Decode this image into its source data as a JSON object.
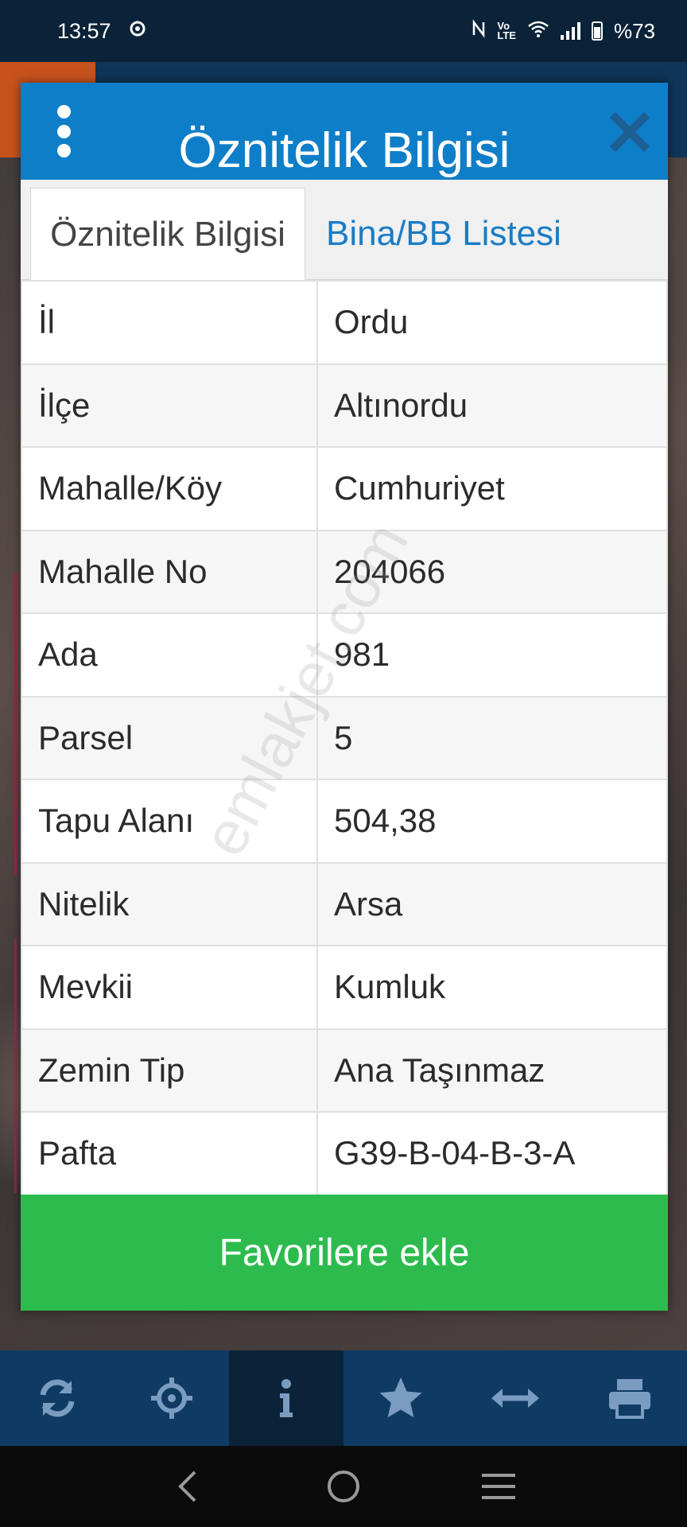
{
  "status_bar": {
    "time": "13:57",
    "battery_text": "%73",
    "icons": [
      "vpn-icon",
      "nfc-icon",
      "volte-icon",
      "wifi-icon",
      "signal-icon",
      "battery-icon"
    ]
  },
  "dialog": {
    "title": "Öznitelik Bilgisi",
    "tabs": [
      {
        "label": "Öznitelik Bilgisi",
        "active": true
      },
      {
        "label": "Bina/BB Listesi",
        "active": false
      }
    ],
    "rows": [
      {
        "key": "İl",
        "value": "Ordu"
      },
      {
        "key": "İlçe",
        "value": "Altınordu"
      },
      {
        "key": "Mahalle/Köy",
        "value": "Cumhuriyet"
      },
      {
        "key": "Mahalle No",
        "value": "204066"
      },
      {
        "key": "Ada",
        "value": "981"
      },
      {
        "key": "Parsel",
        "value": "5"
      },
      {
        "key": "Tapu Alanı",
        "value": "504,38"
      },
      {
        "key": "Nitelik",
        "value": "Arsa"
      },
      {
        "key": "Mevkii",
        "value": "Kumluk"
      },
      {
        "key": "Zemin Tip",
        "value": "Ana Taşınmaz"
      },
      {
        "key": "Pafta",
        "value": "G39-B-04-B-3-A"
      }
    ],
    "favorite_label": "Favorilere ekle"
  },
  "watermark": "emlakjet.com",
  "toolbar": {
    "items": [
      "refresh-icon",
      "locate-icon",
      "info-icon",
      "star-icon",
      "measure-icon",
      "print-icon"
    ],
    "active_index": 2
  },
  "colors": {
    "header": "#0e7ec8",
    "favorite": "#2dbb4e",
    "tab_link": "#1a7cc4",
    "toolbar": "#0f3a63"
  }
}
